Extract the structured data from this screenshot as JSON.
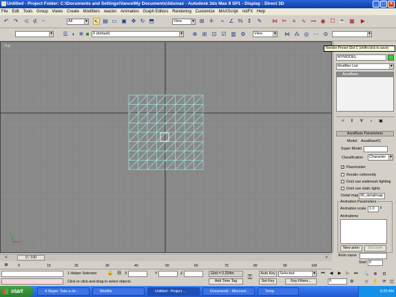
{
  "window": {
    "title": "Untitled     - Project Folder: C:\\Documents and Settings\\Vance\\My Documents\\3dsmax     - Autodesk 3ds Max 9 SP1     - Display : Direct 3D"
  },
  "menu": [
    "File",
    "Edit",
    "Tools",
    "Group",
    "Views",
    "Create",
    "Modifiers",
    "reactor",
    "Animation",
    "Graph Editors",
    "Rendering",
    "Customize",
    "MAXScript",
    "nstFX",
    "Help"
  ],
  "toolbar": {
    "selection_filter": "All",
    "reference_coord": "View",
    "named_selection": "",
    "layer": "0 (default)",
    "layer_coord": "View"
  },
  "viewport": {
    "label": "Top",
    "axis_x": "x",
    "axis_y": "y"
  },
  "tooltip": "Render Preset Slot C (shift+click to save)",
  "command_panel": {
    "object_name": "MYMODEL",
    "modifier_list": "Modifier List",
    "stack_item": "AuraBase",
    "rollout_title": "AuraBase Parameters",
    "model_label": "Model:",
    "model_value": "AuraBase01",
    "super_model_label": "Super Model",
    "classification_label": "Classification",
    "classification_value": "Character",
    "placeholder_label": "Placeholder",
    "render_coherently_label": "Render coherently",
    "dont_walkmesh_label": "Dont use walkmesh lighting",
    "dont_static_label": "Dont use static lights",
    "detail_map_label": "Detail map",
    "detail_map_value": "00_detailmap",
    "animation_params_title": "Animation Parameters",
    "animation_scale_label": "Animation scale",
    "animation_scale_value": "1.0",
    "animations_label": "Animations",
    "new_anim_label": "New anim",
    "del_anim_label": "Del anim",
    "anim_name_label": "Anim name",
    "start_label": "Start",
    "start_value": "0"
  },
  "timeline": {
    "frame_display": "0 / 100",
    "ticks": [
      "0",
      "10",
      "20",
      "30",
      "40",
      "50",
      "60",
      "70",
      "80",
      "90",
      "100"
    ]
  },
  "status": {
    "selection": "1 Helper Selected",
    "prompt": "Click or click-and-drag to select objects",
    "x_label": "X",
    "y_label": "Y",
    "z_label": "Z",
    "grid": "Grid = 0.254m",
    "add_time_tag": "Add Time Tag",
    "auto_key": "Auto Key",
    "set_key": "Set Key",
    "key_mode": "Selected",
    "key_filters": "Key Filters...",
    "frame_value": "0"
  },
  "taskbar": {
    "start": "start",
    "buttons": [
      "4 Skype: Take a de...",
      "Webfile",
      "Untitled     - Project ...",
      "Document1 - Microsof...",
      "Temp"
    ],
    "clock": "9:20 AM"
  }
}
